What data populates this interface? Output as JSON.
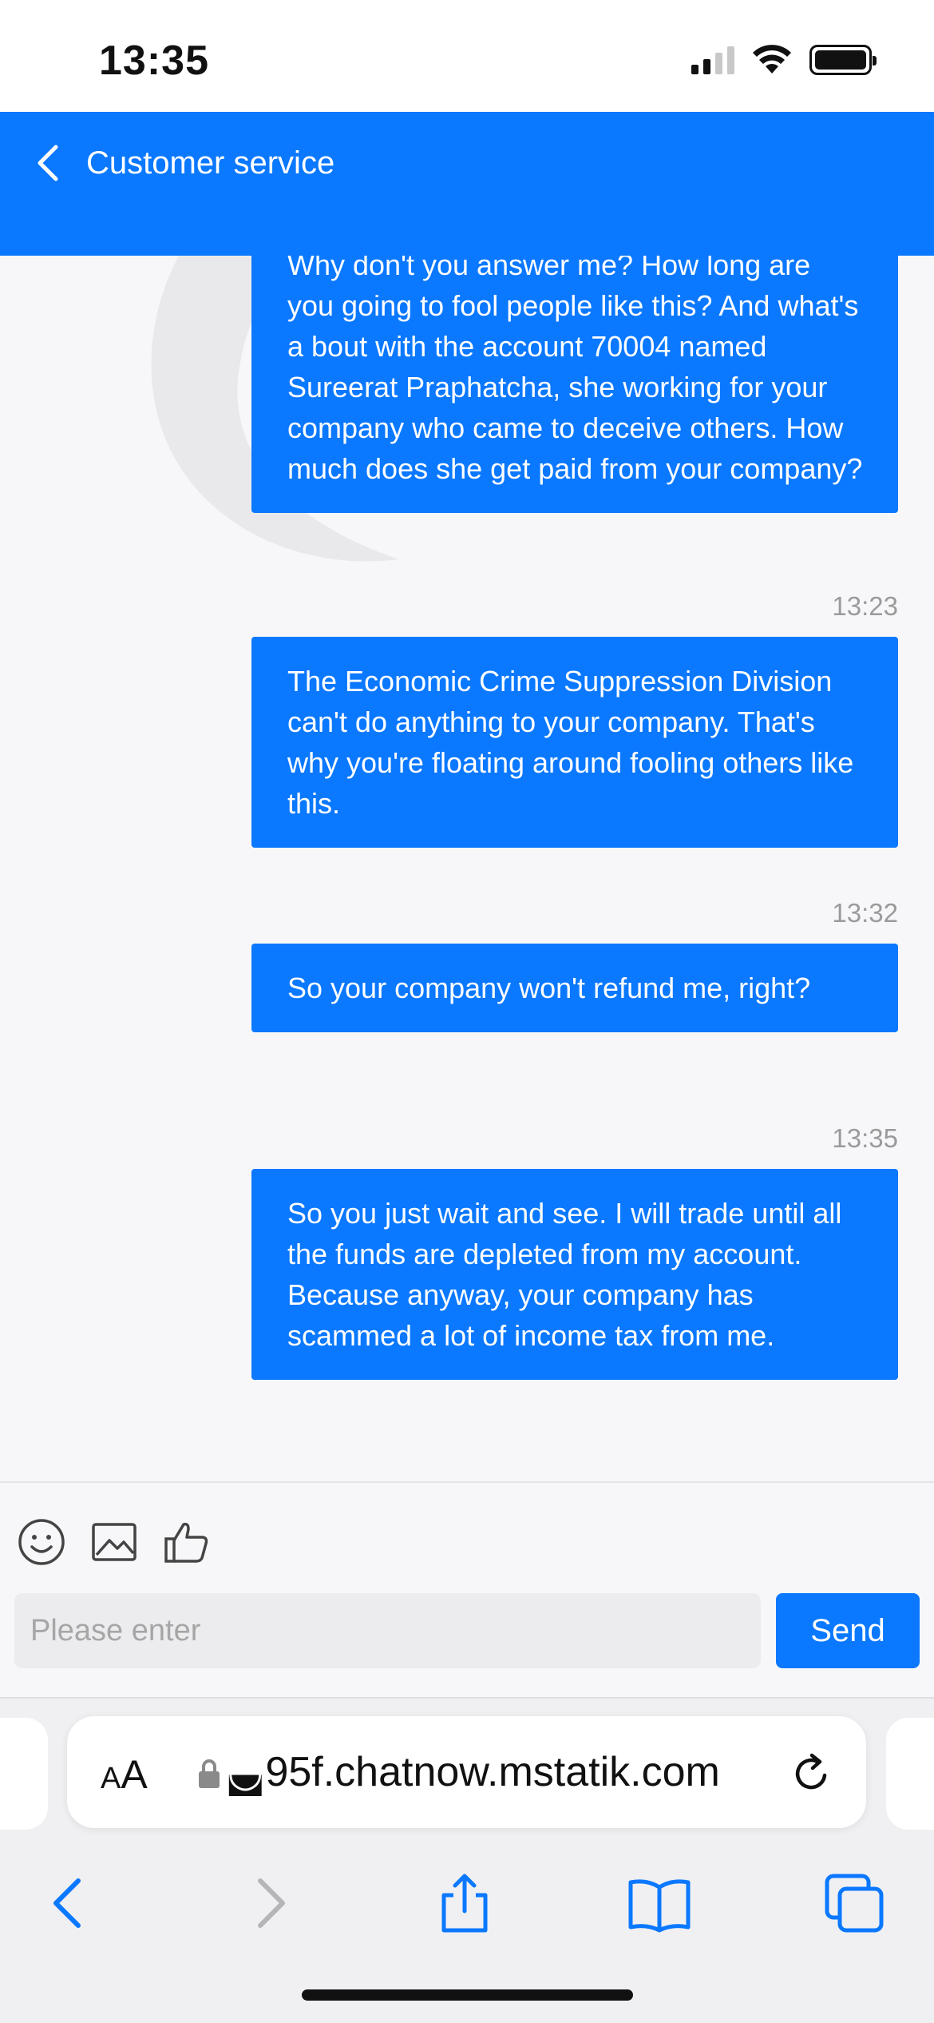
{
  "status_bar": {
    "time": "13:35"
  },
  "header": {
    "title": "Customer service"
  },
  "messages": [
    {
      "text": "Why don't you answer me? How long are you going to fool people like this? And what's a bout with the account 70004 named Sureerat Praphatcha, she working for your company who came to deceive others. How much does she get paid from your company?",
      "timestamp": ""
    },
    {
      "text": "The Economic Crime Suppression Division can't do anything to your company. That's why you're floating around fooling others like this.",
      "timestamp": "13:23"
    },
    {
      "text": "So your company won't refund me, right?",
      "timestamp": "13:32"
    },
    {
      "text": "So you just wait and see. I will trade until all the funds are depleted from my account. Because anyway, your company has scammed a lot of income tax from me.",
      "timestamp": "13:35"
    }
  ],
  "composer": {
    "placeholder": "Please enter",
    "send_label": "Send",
    "tools": [
      "emoji-icon",
      "image-icon",
      "thumbs-up-icon"
    ]
  },
  "browser": {
    "aa_large": "A",
    "aa_small": "A",
    "url": "◛95f.chatnow.mstatik.com",
    "nav": [
      "back-icon",
      "forward-icon",
      "share-icon",
      "bookmarks-icon",
      "tabs-icon"
    ]
  },
  "colors": {
    "accent": "#0a78ff",
    "timestamp": "#9a9a9a"
  }
}
